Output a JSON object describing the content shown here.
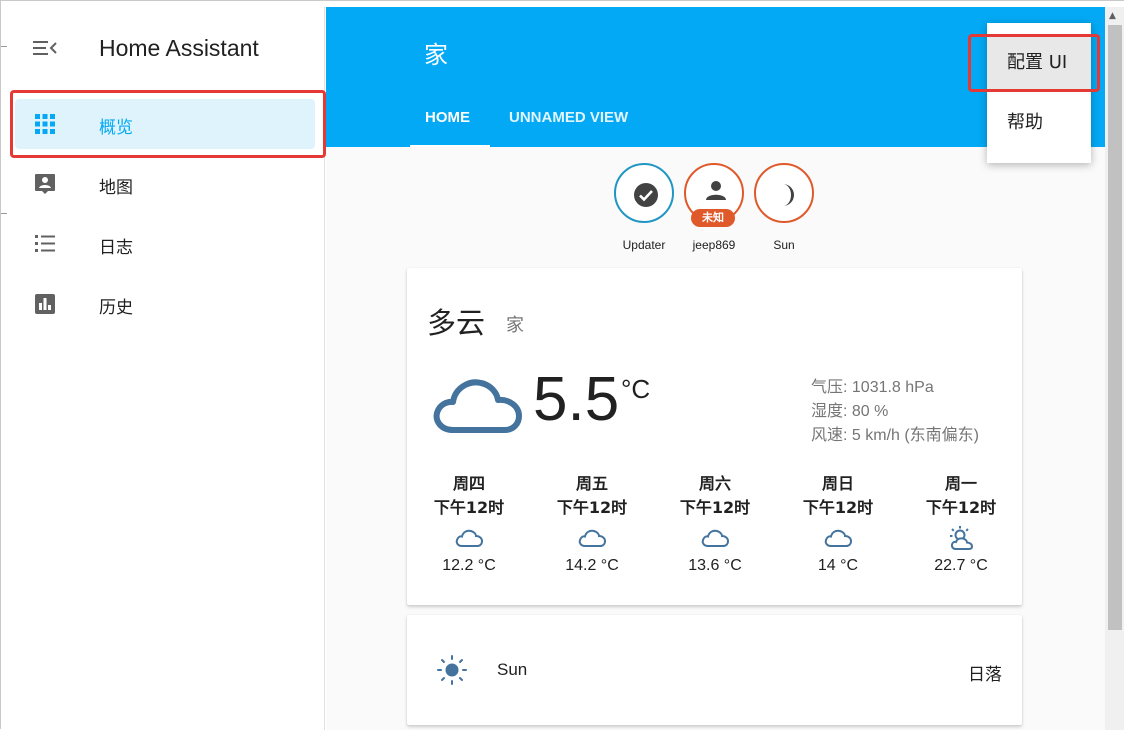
{
  "sidebar": {
    "title": "Home Assistant",
    "items": [
      {
        "label": "概览",
        "icon": "apps-grid-icon",
        "active": true
      },
      {
        "label": "地图",
        "icon": "map-account-icon",
        "active": false
      },
      {
        "label": "日志",
        "icon": "logbook-list-icon",
        "active": false
      },
      {
        "label": "历史",
        "icon": "history-chart-icon",
        "active": false
      }
    ]
  },
  "header": {
    "title": "家",
    "tabs": [
      {
        "label": "HOME",
        "active": true
      },
      {
        "label": "UNNAMED VIEW",
        "active": false
      }
    ]
  },
  "menu": {
    "items": [
      {
        "label": "配置 UI",
        "selected": true
      },
      {
        "label": "帮助",
        "selected": false
      }
    ]
  },
  "badges": [
    {
      "label": "Updater",
      "icon": "check-circle-icon",
      "tag": ""
    },
    {
      "label": "jeep869",
      "icon": "account-icon",
      "tag": "未知"
    },
    {
      "label": "Sun",
      "icon": "moon-icon",
      "tag": ""
    }
  ],
  "weather": {
    "state": "多云",
    "name": "家",
    "temperature": "5.5",
    "unit": "°C",
    "attributes": [
      "气压: 1031.8 hPa",
      "湿度: 80 %",
      "风速: 5 km/h (东南偏东)"
    ],
    "forecast": [
      {
        "day": "周四",
        "time": "下午12时",
        "icon": "cloudy-icon",
        "temp": "12.2 °C"
      },
      {
        "day": "周五",
        "time": "下午12时",
        "icon": "cloudy-icon",
        "temp": "14.2 °C"
      },
      {
        "day": "周六",
        "time": "下午12时",
        "icon": "cloudy-icon",
        "temp": "13.6 °C"
      },
      {
        "day": "周日",
        "time": "下午12时",
        "icon": "cloudy-icon",
        "temp": "14 °C"
      },
      {
        "day": "周一",
        "time": "下午12时",
        "icon": "partly-cloudy-icon",
        "temp": "22.7 °C"
      }
    ]
  },
  "sun_card": {
    "name": "Sun",
    "state": "日落",
    "icon": "sun-icon"
  },
  "colors": {
    "accent": "#03a9f4",
    "highlight": "#e53935",
    "badge_blue": "#2196c3",
    "badge_orange": "#e0592a",
    "weather_icon": "#44739e"
  }
}
